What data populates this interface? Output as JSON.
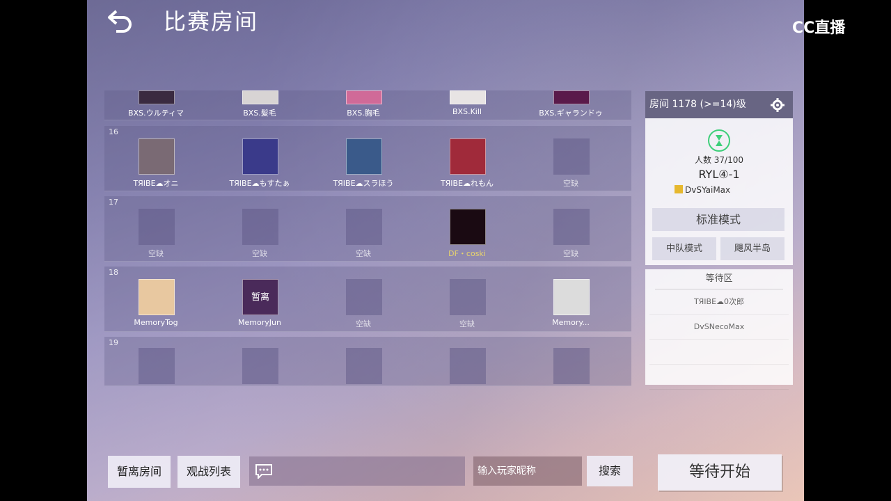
{
  "header": {
    "title": "比赛房间"
  },
  "watermark": "CC直播",
  "rows": [
    {
      "num": "",
      "slots": [
        {
          "name": "BXS.ウルティマ",
          "state": "filled",
          "color": "#3a2a40"
        },
        {
          "name": "BXS.髪毛",
          "state": "filled",
          "color": "#d8d4d4"
        },
        {
          "name": "BXS.胸毛",
          "state": "filled",
          "color": "#d06a98"
        },
        {
          "name": "BXS.Kill",
          "state": "filled",
          "color": "#e8e4e4"
        },
        {
          "name": "BXS.ギャランドゥ",
          "state": "filled",
          "color": "#5a1a4a"
        }
      ]
    },
    {
      "num": "16",
      "slots": [
        {
          "name": "TЯIBE☁オニ",
          "state": "filled",
          "color": "#7a6a74"
        },
        {
          "name": "TЯIBE☁もすたぁ",
          "state": "filled",
          "color": "#3a3a8a"
        },
        {
          "name": "TЯIBE☁スラほう",
          "state": "filled",
          "color": "#3a5a8a"
        },
        {
          "name": "TЯIBE☁れもん",
          "state": "filled",
          "color": "#a02a3a"
        },
        {
          "name": "空缺",
          "state": "empty"
        }
      ]
    },
    {
      "num": "17",
      "slots": [
        {
          "name": "空缺",
          "state": "empty"
        },
        {
          "name": "空缺",
          "state": "empty"
        },
        {
          "name": "空缺",
          "state": "empty"
        },
        {
          "name": "DF・coski",
          "state": "gold",
          "color": "#1a0a12"
        },
        {
          "name": "空缺",
          "state": "empty"
        }
      ]
    },
    {
      "num": "18",
      "slots": [
        {
          "name": "MemoryTog",
          "state": "filled",
          "color": "#e8c8a0"
        },
        {
          "name": "MemoryJun",
          "state": "filled",
          "color": "#4a2a5a",
          "overlay": "暂离"
        },
        {
          "name": "空缺",
          "state": "empty"
        },
        {
          "name": "空缺",
          "state": "empty"
        },
        {
          "name": "Memory...",
          "state": "filled",
          "color": "#dcdcdc"
        }
      ]
    },
    {
      "num": "19",
      "slots": [
        {
          "name": "",
          "state": "empty"
        },
        {
          "name": "",
          "state": "empty"
        },
        {
          "name": "",
          "state": "empty"
        },
        {
          "name": "",
          "state": "empty"
        },
        {
          "name": "",
          "state": "empty"
        }
      ]
    }
  ],
  "room": {
    "title": "房间 1178 (>=14)级",
    "players": "人数 37/100",
    "name": "RYL④-1",
    "owner": "DvSYaiMax",
    "mode": "标准模式",
    "team_mode": "中队模式",
    "map": "飓风半岛"
  },
  "waiting": {
    "title": "等待区",
    "items": [
      "TЯIBE☁0次郎",
      "DvSNecoMax",
      "",
      ""
    ]
  },
  "bottom": {
    "away_label": "暂离房间",
    "spectate_label": "观战列表",
    "search_placeholder": "输入玩家昵称",
    "search_label": "搜索",
    "start_label": "等待开始"
  }
}
